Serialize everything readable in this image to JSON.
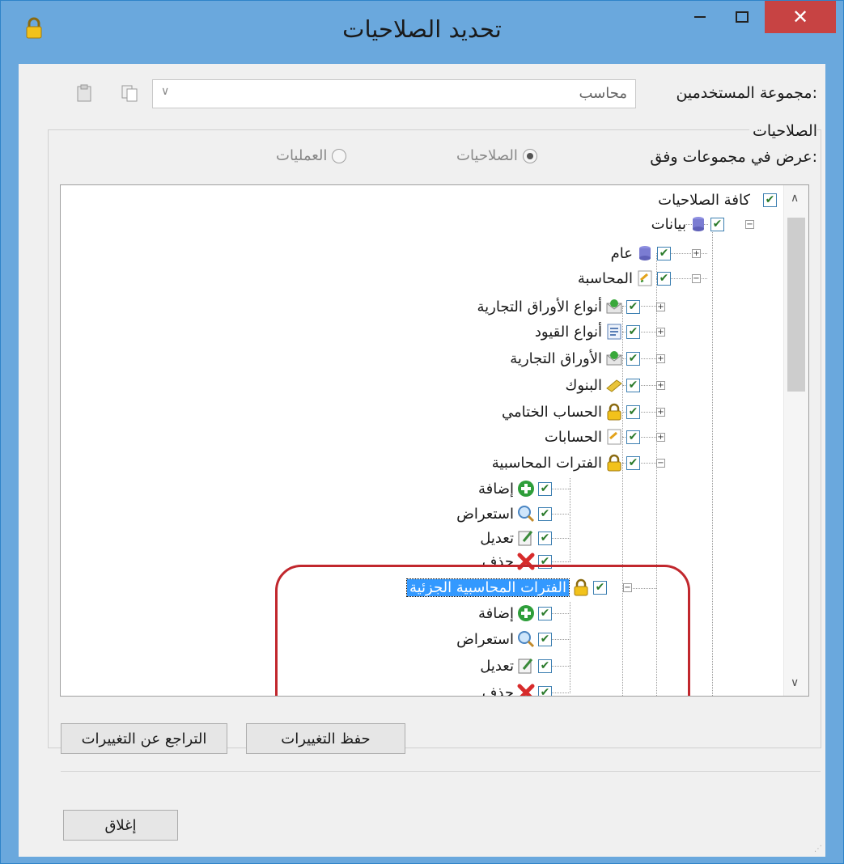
{
  "window": {
    "title": "تحديد الصلاحيات",
    "close_glyph": "✕",
    "accent": "#6aa8dd",
    "close_color": "#c74343"
  },
  "user_group": {
    "label": "مجموعة المستخدمين:",
    "value": "محاسب",
    "icons": [
      "paste-icon",
      "copy-icon"
    ]
  },
  "permissions_group": {
    "label": "الصلاحيات",
    "view_by_label": "عرض في مجموعات وفق:",
    "options": [
      {
        "label": "الصلاحيات",
        "selected": true
      },
      {
        "label": "العمليات",
        "selected": false
      }
    ]
  },
  "tree": {
    "root": "كافة الصلاحيات",
    "data": "بيانات",
    "general": "عام",
    "accounting": "المحاسبة",
    "accounting_children": [
      "أنواع الأوراق التجارية",
      "أنواع القيود",
      "الأوراق التجارية",
      "البنوك",
      "الحساب الختامي",
      "الحسابات",
      "الفترات المحاسبية"
    ],
    "actions": [
      "إضافة",
      "استعراض",
      "تعديل",
      "حذف"
    ],
    "partial_periods": "الفترات المحاسبية الجزئية",
    "selected_item": "الفترات المحاسبية الجزئية",
    "highlight_color": "#c1272d"
  },
  "buttons": {
    "save": "حفظ التغييرات",
    "revert": "التراجع عن التغييرات",
    "close": "إغلاق"
  }
}
